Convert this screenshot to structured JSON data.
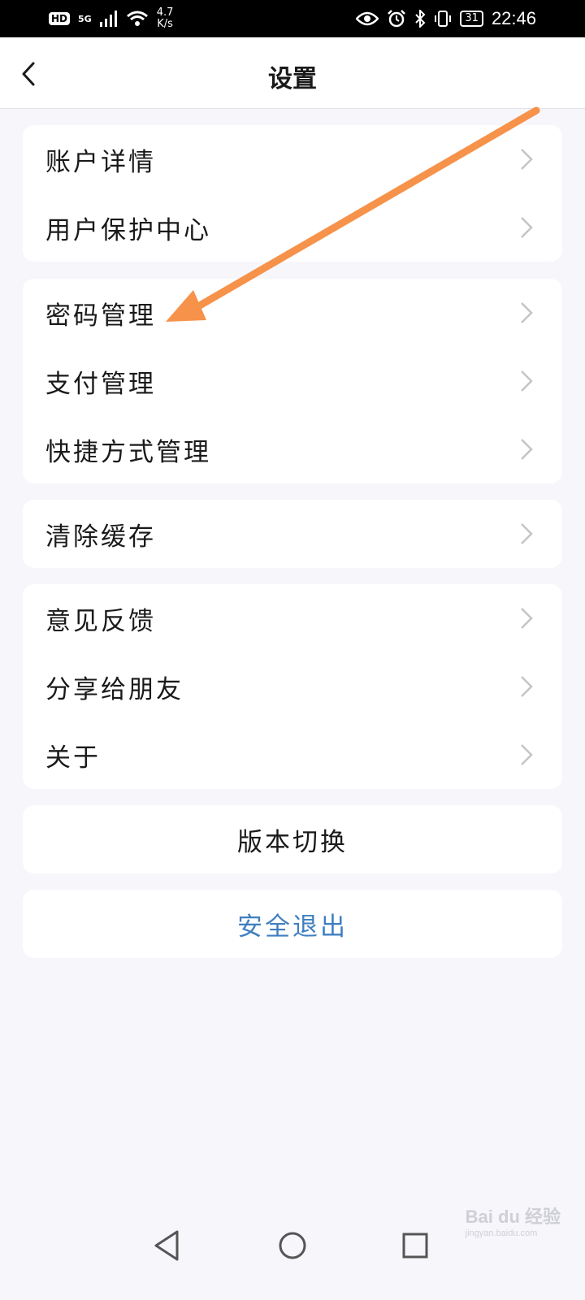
{
  "status_bar": {
    "hd_badge": "HD",
    "network": "5G",
    "speed_value": "4.7",
    "speed_unit": "K/s",
    "battery": "31",
    "time": "22:46"
  },
  "header": {
    "title": "设置"
  },
  "sections": {
    "account": [
      "账户详情",
      "用户保护中心"
    ],
    "management": [
      "密码管理",
      "支付管理",
      "快捷方式管理"
    ],
    "cache": [
      "清除缓存"
    ],
    "misc": [
      "意见反馈",
      "分享给朋友",
      "关于"
    ]
  },
  "buttons": {
    "version_switch": "版本切换",
    "logout": "安全退出"
  },
  "colors": {
    "background": "#f6f6fb",
    "logout_text": "#3f7fc1",
    "annotation_arrow": "#f6924a"
  },
  "watermark": {
    "text": "Bai du 经验",
    "sub": "jingyan.baidu.com"
  }
}
